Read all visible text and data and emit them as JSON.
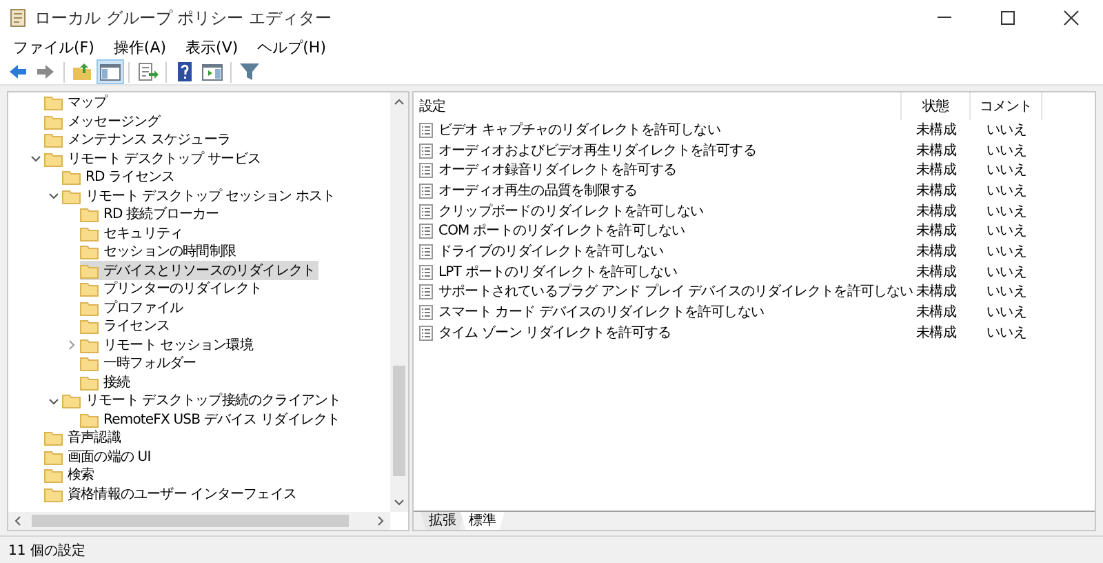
{
  "window": {
    "title": "ローカル グループ ポリシー エディター"
  },
  "menu": [
    "ファイル(F)",
    "操作(A)",
    "表示(V)",
    "ヘルプ(H)"
  ],
  "toolbar": [
    {
      "kind": "back",
      "pressed": false
    },
    {
      "kind": "forward",
      "pressed": false
    },
    {
      "kind": "sep"
    },
    {
      "kind": "up",
      "pressed": false
    },
    {
      "kind": "tree",
      "pressed": true
    },
    {
      "kind": "sep"
    },
    {
      "kind": "export",
      "pressed": false
    },
    {
      "kind": "sep"
    },
    {
      "kind": "help",
      "pressed": false
    },
    {
      "kind": "pane",
      "pressed": false
    },
    {
      "kind": "sep"
    },
    {
      "kind": "filter",
      "pressed": false
    }
  ],
  "tree": [
    {
      "label": "マップ",
      "selected": false
    },
    {
      "label": "メッセージング",
      "selected": false
    },
    {
      "label": "メンテナンス スケジューラ",
      "selected": false
    },
    {
      "label": "リモート デスクトップ サービス",
      "selected": false,
      "expanded": true,
      "children": [
        {
          "label": "RD ライセンス",
          "selected": false
        },
        {
          "label": "リモート デスクトップ セッション ホスト",
          "selected": false,
          "expanded": true,
          "children": [
            {
              "label": "RD 接続ブローカー",
              "selected": false
            },
            {
              "label": "セキュリティ",
              "selected": false
            },
            {
              "label": "セッションの時間制限",
              "selected": false
            },
            {
              "label": "デバイスとリソースのリダイレクト",
              "selected": true
            },
            {
              "label": "プリンターのリダイレクト",
              "selected": false
            },
            {
              "label": "プロファイル",
              "selected": false
            },
            {
              "label": "ライセンス",
              "selected": false
            },
            {
              "label": "リモート セッション環境",
              "selected": false,
              "expanded": false
            },
            {
              "label": "一時フォルダー",
              "selected": false
            },
            {
              "label": "接続",
              "selected": false
            }
          ]
        },
        {
          "label": "リモート デスクトップ接続のクライアント",
          "selected": false,
          "expanded": true,
          "children": [
            {
              "label": "RemoteFX USB デバイス リダイレクト",
              "selected": false
            }
          ]
        }
      ]
    },
    {
      "label": "音声認識",
      "selected": false
    },
    {
      "label": "画面の端の UI",
      "selected": false
    },
    {
      "label": "検索",
      "selected": false
    },
    {
      "label": "資格情報のユーザー インターフェイス",
      "selected": false
    }
  ],
  "table": {
    "columns": [
      "設定",
      "状態",
      "コメント"
    ],
    "rows": [
      [
        "ビデオ キャプチャのリダイレクトを許可しない",
        "未構成",
        "いいえ"
      ],
      [
        "オーディオおよびビデオ再生リダイレクトを許可する",
        "未構成",
        "いいえ"
      ],
      [
        "オーディオ録音リダイレクトを許可する",
        "未構成",
        "いいえ"
      ],
      [
        "オーディオ再生の品質を制限する",
        "未構成",
        "いいえ"
      ],
      [
        "クリップボードのリダイレクトを許可しない",
        "未構成",
        "いいえ"
      ],
      [
        "COM ポートのリダイレクトを許可しない",
        "未構成",
        "いいえ"
      ],
      [
        "ドライブのリダイレクトを許可しない",
        "未構成",
        "いいえ"
      ],
      [
        "LPT ポートのリダイレクトを許可しない",
        "未構成",
        "いいえ"
      ],
      [
        "サポートされているプラグ アンド プレイ デバイスのリダイレクトを許可しない",
        "未構成",
        "いいえ"
      ],
      [
        "スマート カード デバイスのリダイレクトを許可しない",
        "未構成",
        "いいえ"
      ],
      [
        "タイム ゾーン リダイレクトを許可する",
        "未構成",
        "いいえ"
      ]
    ]
  },
  "view_tabs": [
    {
      "label": "拡張",
      "selected": false
    },
    {
      "label": "標準",
      "selected": true
    }
  ],
  "status_bar": "11 個の設定"
}
